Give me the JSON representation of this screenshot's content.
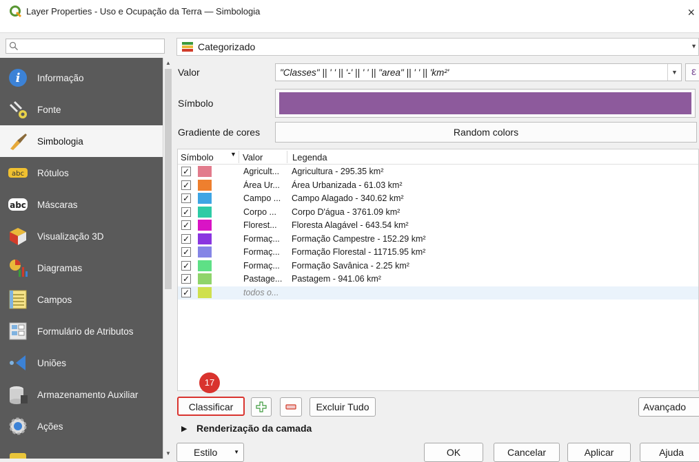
{
  "window": {
    "title": "Layer Properties - Uso e Ocupação da Terra — Simbologia",
    "close_glyph": "×"
  },
  "sidebar": {
    "items": [
      {
        "label": "Informação",
        "icon": "info-icon"
      },
      {
        "label": "Fonte",
        "icon": "source-icon"
      },
      {
        "label": "Simbologia",
        "icon": "symbology-icon"
      },
      {
        "label": "Rótulos",
        "icon": "labels-icon"
      },
      {
        "label": "Máscaras",
        "icon": "masks-icon"
      },
      {
        "label": "Visualização 3D",
        "icon": "3d-view-icon"
      },
      {
        "label": "Diagramas",
        "icon": "diagrams-icon"
      },
      {
        "label": "Campos",
        "icon": "fields-icon"
      },
      {
        "label": "Formulário de Atributos",
        "icon": "attributes-form-icon"
      },
      {
        "label": "Uniões",
        "icon": "joins-icon"
      },
      {
        "label": "Armazenamento Auxiliar",
        "icon": "auxiliary-storage-icon"
      },
      {
        "label": "Ações",
        "icon": "actions-icon"
      }
    ],
    "selected_index": 2
  },
  "renderer": {
    "label": "Categorizado"
  },
  "form": {
    "valor_label": "Valor",
    "valor_expression": "\"Classes\" || ' ' || '-' || ' ' || \"area\" || ' ' || 'km²'",
    "simbolo_label": "Símbolo",
    "symbol_color": "#8d5a9c",
    "gradiente_label": "Gradiente de cores",
    "ramp_value": "Random colors",
    "expr_glyph": "ε"
  },
  "table": {
    "headers": {
      "symbol": "Símbolo",
      "value": "Valor",
      "legend": "Legenda"
    },
    "rows": [
      {
        "value": "Agricult...",
        "legend": "Agricultura - 295.35 km²",
        "color": "#e27b8c"
      },
      {
        "value": "Área Ur...",
        "legend": "Área Urbanizada - 61.03 km²",
        "color": "#ee7f2e"
      },
      {
        "value": "Campo ...",
        "legend": "Campo Alagado - 340.62 km²",
        "color": "#3ea5e4"
      },
      {
        "value": "Corpo ...",
        "legend": "Corpo D'água - 3761.09 km²",
        "color": "#2ecba5"
      },
      {
        "value": "Florest...",
        "legend": "Floresta Alagável - 643.54 km²",
        "color": "#d914c5"
      },
      {
        "value": "Formaç...",
        "legend": "Formação Campestre - 152.29 km²",
        "color": "#8a35e0"
      },
      {
        "value": "Formaç...",
        "legend": "Formação Florestal - 11715.95 km²",
        "color": "#8585e6"
      },
      {
        "value": "Formaç...",
        "legend": "Formação Savânica - 2.25 km²",
        "color": "#5ee086"
      },
      {
        "value": "Pastage...",
        "legend": "Pastagem - 941.06 km²",
        "color": "#8fd46b"
      },
      {
        "value": "todos o...",
        "legend": "",
        "color": "#cfe04e"
      }
    ]
  },
  "step_badge": "17",
  "buttons": {
    "classify": "Classificar",
    "delete_all": "Excluir Tudo",
    "advanced": "Avançado",
    "style": "Estilo",
    "ok": "OK",
    "cancel": "Cancelar",
    "apply": "Aplicar",
    "help": "Ajuda"
  },
  "section": {
    "rendering": "Renderização da camada"
  }
}
